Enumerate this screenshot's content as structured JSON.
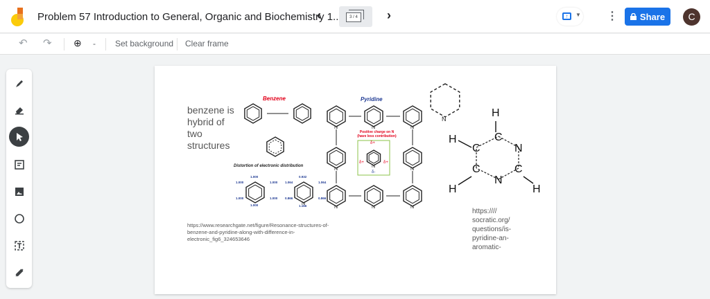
{
  "header": {
    "title": "Problem 57 Introduction to General, Organic and Biochemistry 1...",
    "frame_indicator": "3 / 4",
    "share_label": "Share",
    "avatar_letter": "C"
  },
  "toolbar": {
    "set_background": "Set background",
    "clear_frame": "Clear frame"
  },
  "tools": [
    "pen-icon",
    "eraser-icon",
    "select-icon",
    "sticky-note-icon",
    "image-icon",
    "circle-icon",
    "text-box-icon",
    "laser-icon"
  ],
  "frame": {
    "note_lines": [
      "benzene is",
      "hybrid of",
      "two",
      "structures"
    ],
    "figure": {
      "benzene_title": "Benzene",
      "pyridine_title": "Pyridine",
      "distortion_title": "Distortion of electronic distribution",
      "positive_charge_note": "Positive charge on N",
      "less_contribution_note": "(have less contribution)",
      "benzene_values": [
        "1.000",
        "1.000",
        "1.000",
        "1.000",
        "1.000",
        "1.000"
      ],
      "pyridine_values": [
        "0.932",
        "1.064",
        "1.064",
        "0.866",
        "0.866",
        "1.166"
      ],
      "delta_plus": "δ+",
      "delta_minus": "δ-"
    },
    "source_url_1": "https://www.researchgate.net/figure/Resonance-structures-of-benzene-and-pyridine-along-with-difference-in-electronic_fig6_324653646",
    "source_url_2": "https://// socratic.org/ questions/is- pyridine-an- aromatic-",
    "pyrimidine_atoms": {
      "H": "H",
      "C": "C",
      "N": "N"
    }
  },
  "colors": {
    "accent": "#1a73e8",
    "red": "#e2001a",
    "navy": "#1f3a93"
  }
}
